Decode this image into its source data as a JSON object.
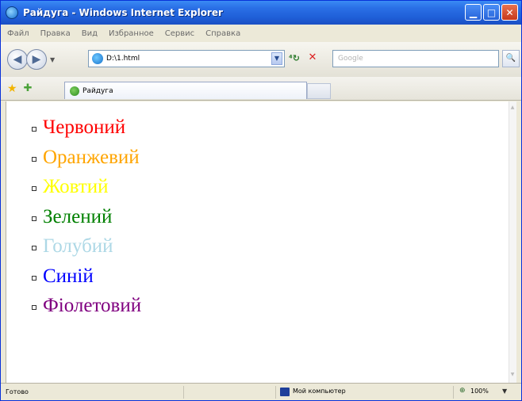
{
  "window": {
    "title": "Райдуга - Windows Internet Explorer"
  },
  "menu": [
    "Файл",
    "Правка",
    "Вид",
    "Избранное",
    "Сервис",
    "Справка"
  ],
  "address": {
    "url": "D:\\1.html"
  },
  "search": {
    "placeholder": "Google"
  },
  "tab": {
    "label": "Райдуга"
  },
  "colors_list": [
    {
      "label": "Червоний",
      "color": "#ff0000"
    },
    {
      "label": "Оранжевий",
      "color": "#ffa500"
    },
    {
      "label": "Жовтий",
      "color": "#ffff00"
    },
    {
      "label": "Зелений",
      "color": "#008000"
    },
    {
      "label": "Голубий",
      "color": "#add8e6"
    },
    {
      "label": "Синій",
      "color": "#0000ff"
    },
    {
      "label": "Фіолетовий",
      "color": "#800080"
    }
  ],
  "status": {
    "text": "Готово",
    "zone": "Мой компьютер",
    "zoom": "100%"
  },
  "icons": {
    "window": "ie-icon",
    "back": "back-arrow-icon",
    "forward": "forward-arrow-icon",
    "refresh": "refresh-icon",
    "stop": "stop-icon",
    "search": "search-icon",
    "favorites": "star-icon",
    "add_favorites": "add-favorite-icon",
    "zone": "computer-icon",
    "zoom": "zoom-icon"
  }
}
